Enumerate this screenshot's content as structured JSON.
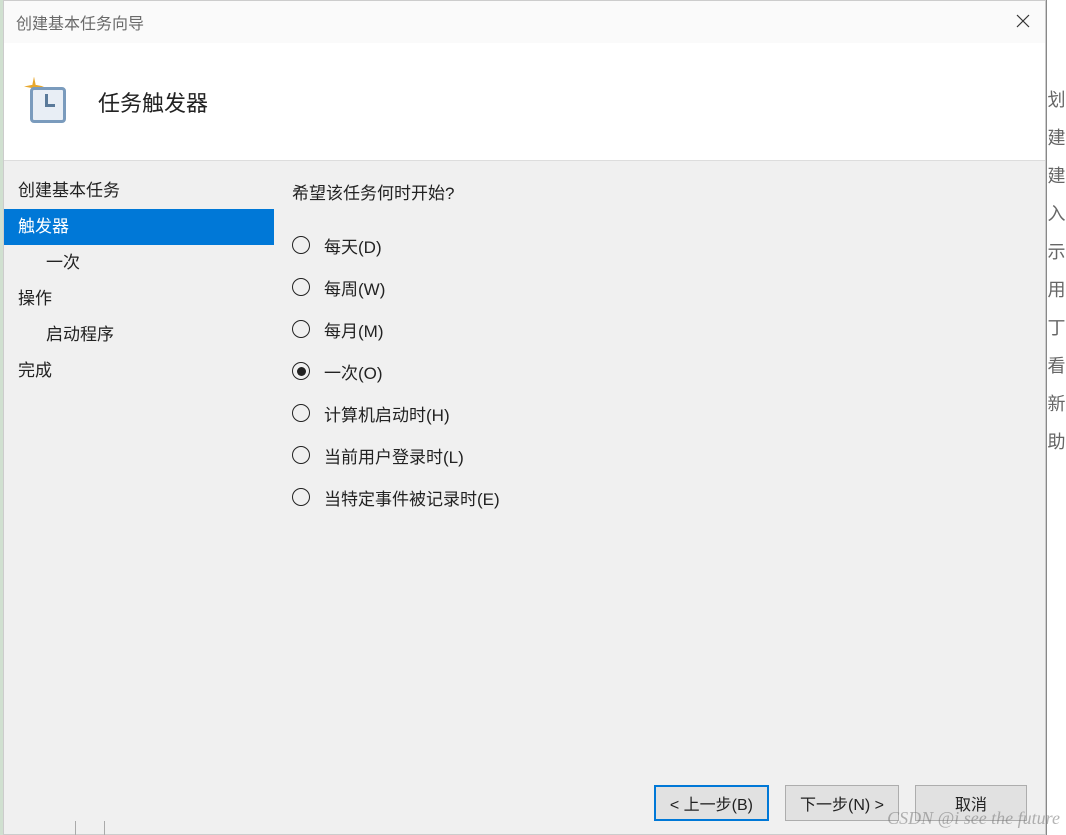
{
  "window": {
    "title": "创建基本任务向导"
  },
  "header": {
    "title": "任务触发器"
  },
  "sidebar": {
    "items": [
      {
        "label": "创建基本任务",
        "active": false,
        "indent": false
      },
      {
        "label": "触发器",
        "active": true,
        "indent": false
      },
      {
        "label": "一次",
        "active": false,
        "indent": true
      },
      {
        "label": "操作",
        "active": false,
        "indent": false
      },
      {
        "label": "启动程序",
        "active": false,
        "indent": true
      },
      {
        "label": "完成",
        "active": false,
        "indent": false
      }
    ]
  },
  "content": {
    "question": "希望该任务何时开始?",
    "options": [
      {
        "label": "每天(D)",
        "selected": false
      },
      {
        "label": "每周(W)",
        "selected": false
      },
      {
        "label": "每月(M)",
        "selected": false
      },
      {
        "label": "一次(O)",
        "selected": true
      },
      {
        "label": "计算机启动时(H)",
        "selected": false
      },
      {
        "label": "当前用户登录时(L)",
        "selected": false
      },
      {
        "label": "当特定事件被记录时(E)",
        "selected": false
      }
    ]
  },
  "footer": {
    "back": "< 上一步(B)",
    "next": "下一步(N) >",
    "cancel": "取消"
  },
  "right_partial": {
    "items": [
      "划",
      "建",
      "建",
      "入",
      "示",
      "用",
      "丁",
      "看",
      "新",
      "助"
    ]
  },
  "watermark": "CSDN @i see the future"
}
